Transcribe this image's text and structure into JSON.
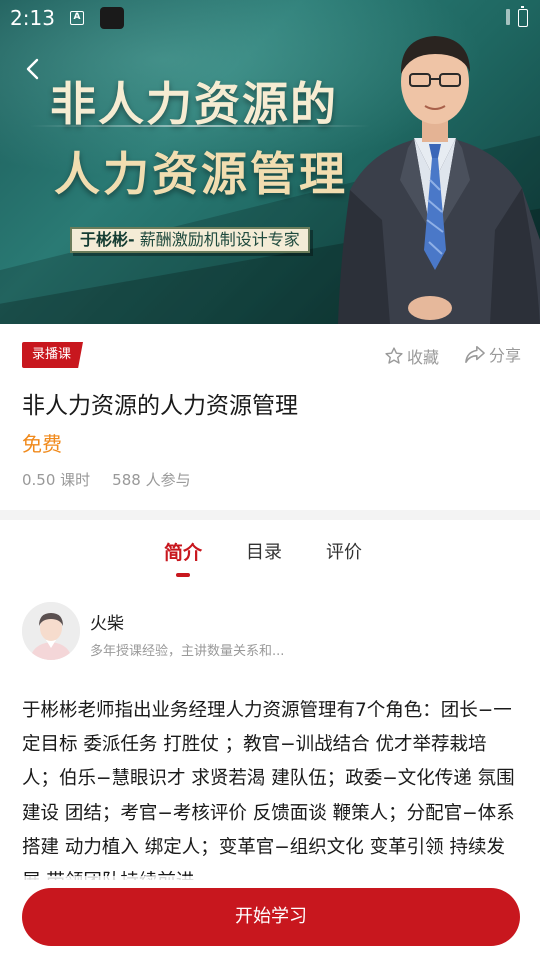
{
  "status_bar": {
    "time": "2:13",
    "notification_icon": "A"
  },
  "banner": {
    "title_line1": "非人力资源的",
    "title_line2": "人力资源管理",
    "tag_name": "于彬彬-",
    "tag_title": " 薪酬激励机制设计专家"
  },
  "course": {
    "badge": "录播课",
    "favorite_label": "收藏",
    "share_label": "分享",
    "title": "非人力资源的人力资源管理",
    "price": "免费",
    "hours": "0.50 课时",
    "participants": "588 人参与"
  },
  "tabs": [
    {
      "label": "简介",
      "active": true
    },
    {
      "label": "目录",
      "active": false
    },
    {
      "label": "评价",
      "active": false
    }
  ],
  "teacher": {
    "name": "火柴",
    "bio": "多年授课经验，主讲数量关系和..."
  },
  "description": "于彬彬老师指出业务经理人力资源管理有7个角色：团长−一定目标 委派任务 打胜仗 ；教官−训战结合 优才举荐栽培人；伯乐−慧眼识才 求贤若渴 建队伍；政委−文化传递 氛围建设 团结；考官−考核评价 反馈面谈 鞭策人；分配官−体系搭建 动力植入 绑定人；变革官−组织文化 变革引领 持续发展 带领团队持续前进",
  "start_button": "开始学习",
  "colors": {
    "accent": "#c8171e",
    "price": "#f08a1c",
    "banner": "#1f6862"
  }
}
